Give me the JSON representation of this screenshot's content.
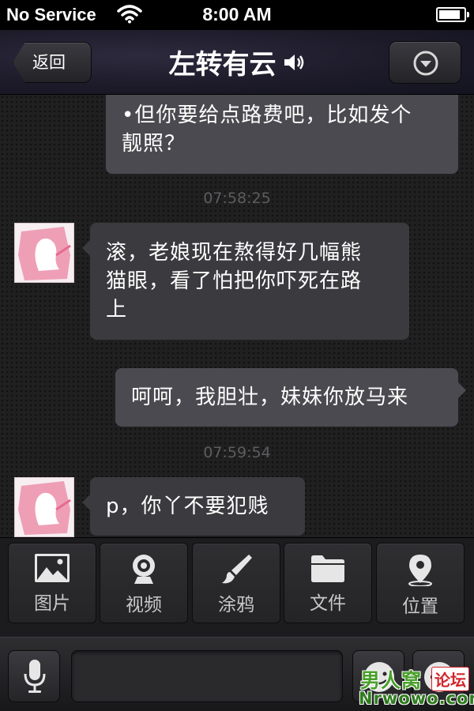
{
  "status_bar": {
    "carrier": "No Service",
    "time": "8:00 AM"
  },
  "nav": {
    "back_label": "返回",
    "title": "左转有云",
    "icons": {
      "speaker": "speaker-icon",
      "menu": "chevron-down-circle-icon"
    }
  },
  "chat": {
    "messages": [
      {
        "sender": "self",
        "lines": [
          "•但你要给点路费吧，比如发个",
          "靓照？"
        ]
      },
      {
        "timestamp": "07:58:25"
      },
      {
        "sender": "other",
        "lines": [
          "滚，老娘现在熬得好几幅熊",
          "猫眼，看了怕把你吓死在路",
          "上"
        ]
      },
      {
        "sender": "self",
        "lines": [
          "呵呵，我胆壮，妹妹你放马来"
        ]
      },
      {
        "timestamp": "07:59:54"
      },
      {
        "sender": "other",
        "lines": [
          "p，你丫不要犯贱"
        ]
      }
    ]
  },
  "tools": [
    {
      "label": "图片",
      "icon": "image-icon"
    },
    {
      "label": "视频",
      "icon": "webcam-icon"
    },
    {
      "label": "涂鸦",
      "icon": "brush-icon"
    },
    {
      "label": "文件",
      "icon": "folder-icon"
    },
    {
      "label": "位置",
      "icon": "location-pin-icon"
    }
  ],
  "input_bar": {
    "text_value": "",
    "icons": {
      "mic": "microphone-icon",
      "emoji": "emoji-icon",
      "plus": "plus-icon"
    }
  },
  "watermark": {
    "top": "男人窝",
    "badge": "论坛",
    "bottom": "Nrwowo.com"
  },
  "colors": {
    "chat_bg": "#202021",
    "bubble_self": "#4a4a50",
    "bubble_other": "#3b3b3f",
    "timestamp": "#5d5d60"
  }
}
